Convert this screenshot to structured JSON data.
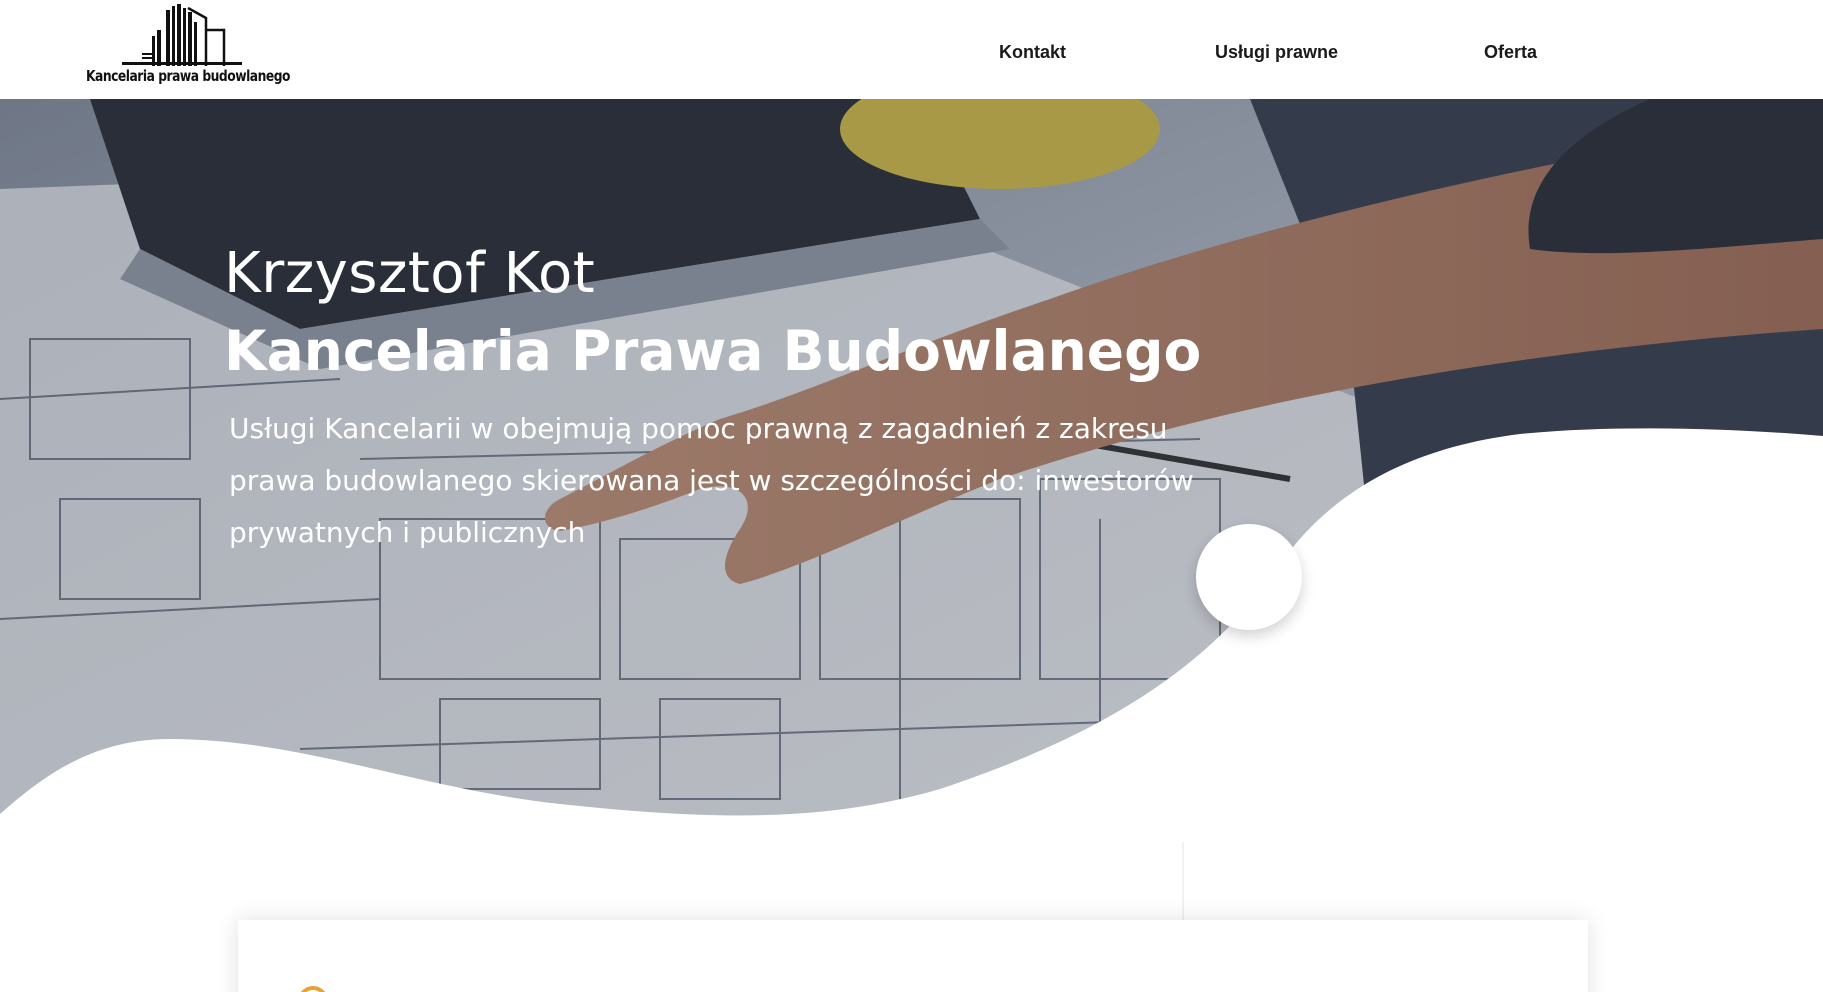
{
  "header": {
    "logo_text": "Kancelaria prawa budowlanego",
    "nav": [
      {
        "label": "Kontakt"
      },
      {
        "label": "Usługi prawne"
      },
      {
        "label": "Oferta"
      }
    ]
  },
  "hero": {
    "name": "Krzysztof Kot",
    "title": "Kancelaria Prawa Budowlanego",
    "description": "Usługi Kancelarii w obejmują pomoc prawną z zagadnień z zakresu prawa budowlanego skierowana jest w szczególności do: inwestorów prywatnych i publicznych"
  },
  "colors": {
    "accent": "#e8a13a",
    "text_dark": "#1a1a1a"
  }
}
